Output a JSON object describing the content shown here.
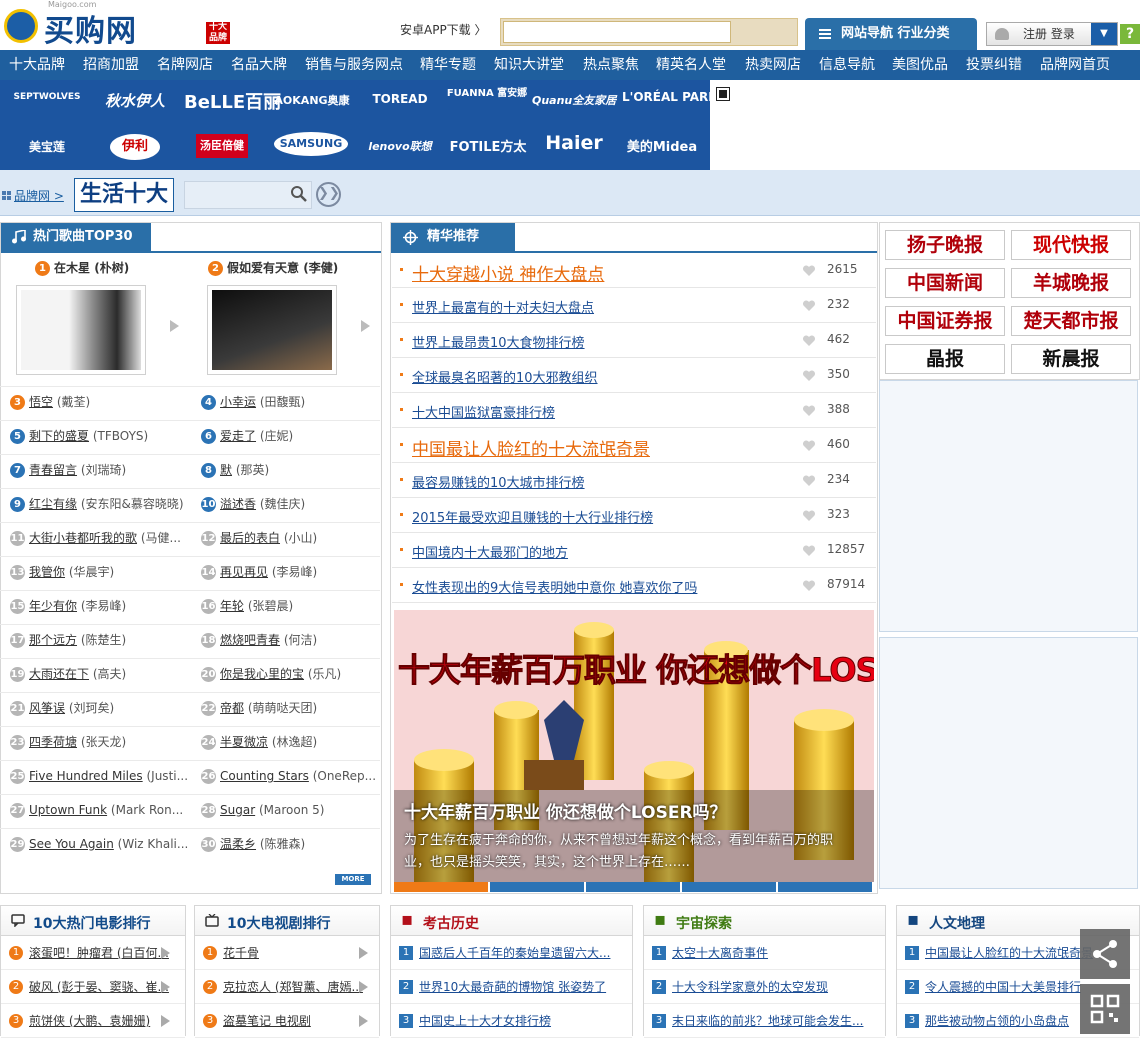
{
  "header": {
    "logo_text": "买购网",
    "logo_sub": "Maigoo.com",
    "logo_badge": "十大品牌",
    "app_download": "安卓APP下载 〉",
    "search_placeholder": "",
    "nav_tab": "网站导航  行业分类",
    "login": "注册 登录",
    "help": "?"
  },
  "nav": [
    "十大品牌",
    "招商加盟",
    "名牌网店",
    "名品大牌",
    "销售与服务网点",
    "精华专题",
    "知识大讲堂",
    "热点聚焦",
    "精英名人堂",
    "热卖网店",
    "信息导航",
    "美图优品",
    "投票纠错",
    "品牌网首页"
  ],
  "brands": [
    {
      "name": "SEPTWOLVES"
    },
    {
      "name": "秋水伊人"
    },
    {
      "name": "BeLLE百丽"
    },
    {
      "name": "AOKANG奥康"
    },
    {
      "name": "TOREAD"
    },
    {
      "name": "FUANNA 富安娜"
    },
    {
      "name": "Quanu全友家居"
    },
    {
      "name": "L'ORÉAL PARIS"
    },
    {
      "name": "美宝莲"
    },
    {
      "name": "伊利"
    },
    {
      "name": "汤臣倍健"
    },
    {
      "name": "SAMSUNG"
    },
    {
      "name": "lenovo联想"
    },
    {
      "name": "FOTILE方太"
    },
    {
      "name": "Haier"
    },
    {
      "name": "美的Midea"
    }
  ],
  "breadcrumb": {
    "link": "品牌网 >",
    "title": "生活十大"
  },
  "songs": {
    "title": "热门歌曲TOP30",
    "top": [
      {
        "rank": "1",
        "title": "在木星",
        "artist": "(朴树)"
      },
      {
        "rank": "2",
        "title": "假如爱有天意",
        "artist": "(李健)"
      }
    ],
    "list": [
      {
        "rank": "3",
        "title": "悟空",
        "artist": "(戴荃)"
      },
      {
        "rank": "4",
        "title": "小幸运",
        "artist": "(田馥甄)"
      },
      {
        "rank": "5",
        "title": "剩下的盛夏",
        "artist": "(TFBOYS)"
      },
      {
        "rank": "6",
        "title": "爱走了",
        "artist": "(庄妮)"
      },
      {
        "rank": "7",
        "title": "青春留言",
        "artist": "(刘瑞琦)"
      },
      {
        "rank": "8",
        "title": "默",
        "artist": "(那英)"
      },
      {
        "rank": "9",
        "title": "红尘有缘",
        "artist": "(安东阳&慕容晓晓)"
      },
      {
        "rank": "10",
        "title": "溢述香",
        "artist": "(魏佳庆)"
      },
      {
        "rank": "11",
        "title": "大街小巷都听我的歌",
        "artist": "(马健..."
      },
      {
        "rank": "12",
        "title": "最后的表白",
        "artist": "(小山)"
      },
      {
        "rank": "13",
        "title": "我管你",
        "artist": "(华晨宇)"
      },
      {
        "rank": "14",
        "title": "再见再见",
        "artist": "(李易峰)"
      },
      {
        "rank": "15",
        "title": "年少有你",
        "artist": "(李易峰)"
      },
      {
        "rank": "16",
        "title": "年轮",
        "artist": "(张碧晨)"
      },
      {
        "rank": "17",
        "title": "那个远方",
        "artist": "(陈楚生)"
      },
      {
        "rank": "18",
        "title": "燃烧吧青春",
        "artist": "(何洁)"
      },
      {
        "rank": "19",
        "title": "大雨还在下",
        "artist": "(高夫)"
      },
      {
        "rank": "20",
        "title": "你是我心里的宝",
        "artist": "(乐凡)"
      },
      {
        "rank": "21",
        "title": "风筝误",
        "artist": "(刘珂矣)"
      },
      {
        "rank": "22",
        "title": "帝都",
        "artist": "(萌萌哒天团)"
      },
      {
        "rank": "23",
        "title": "四季荷塘",
        "artist": "(张天龙)"
      },
      {
        "rank": "24",
        "title": "半夏微凉",
        "artist": "(林逸超)"
      },
      {
        "rank": "25",
        "title": "Five Hundred Miles",
        "artist": "(Justi..."
      },
      {
        "rank": "26",
        "title": "Counting Stars",
        "artist": "(OneRep..."
      },
      {
        "rank": "27",
        "title": "Uptown Funk",
        "artist": "(Mark Ron..."
      },
      {
        "rank": "28",
        "title": "Sugar",
        "artist": "(Maroon 5)"
      },
      {
        "rank": "29",
        "title": "See You Again",
        "artist": "(Wiz Khali..."
      },
      {
        "rank": "30",
        "title": "温柔乡",
        "artist": "(陈雅森)"
      }
    ],
    "more": "MORE"
  },
  "featured": {
    "title": "精华推荐",
    "items": [
      {
        "title": "十大穿越小说 神作大盘点",
        "count": "2615",
        "big": true
      },
      {
        "title": "世界上最富有的十对夫妇大盘点",
        "count": "232"
      },
      {
        "title": "世界上最昂贵10大食物排行榜",
        "count": "462"
      },
      {
        "title": "全球最臭名昭著的10大邪教组织",
        "count": "350"
      },
      {
        "title": "十大中国监狱富豪排行榜",
        "count": "388"
      },
      {
        "title": "中国最让人脸红的十大流氓奇景",
        "count": "460",
        "big": true
      },
      {
        "title": "最容易赚钱的10大城市排行榜",
        "count": "234"
      },
      {
        "title": "2015年最受欢迎且赚钱的十大行业排行榜",
        "count": "323"
      },
      {
        "title": "中国境内十大最邪门的地方",
        "count": "12857"
      },
      {
        "title": "女性表现出的9大信号表明她中意你 她喜欢你了吗",
        "count": "87914"
      }
    ],
    "banner": {
      "headline": "十大年薪百万职业 你还想做个LOSER吗?",
      "caption": "十大年薪百万职业 你还想做个LOSER吗？",
      "desc": "为了生存在疲于奔命的你，从来不曾想过年薪这个概念，看到年薪百万的职业，也只是摇头笑笑，其实，这个世界上存在……"
    }
  },
  "newspapers": [
    "扬子晚报",
    "现代快报",
    "中国新闻",
    "羊城晚报",
    "中国证券报",
    "楚天都市报",
    "晶报",
    "新晨报"
  ],
  "bottom": {
    "movies": {
      "title": "10大热门电影排行",
      "items": [
        {
          "rank": "1",
          "text": "滚蛋吧！肿瘤君 (白百何..."
        },
        {
          "rank": "2",
          "text": "破风 (彭于晏、窦骁、崔..."
        },
        {
          "rank": "3",
          "text": "煎饼侠 (大鹏、袁姗姗)"
        }
      ]
    },
    "tv": {
      "title": "10大电视剧排行",
      "items": [
        {
          "rank": "1",
          "text": "花千骨"
        },
        {
          "rank": "2",
          "text": "克拉恋人 (郑智薰、唐嫣..."
        },
        {
          "rank": "3",
          "text": "盗墓笔记 电视剧"
        }
      ]
    },
    "history": {
      "title": "考古历史",
      "items": [
        {
          "rank": "1",
          "text": "国惑后人千百年的秦始皇遗留六大..."
        },
        {
          "rank": "2",
          "text": "世界10大最奇葩的博物馆 张姿势了"
        },
        {
          "rank": "3",
          "text": "中国史上十大才女排行榜"
        }
      ]
    },
    "space": {
      "title": "宇宙探索",
      "items": [
        {
          "rank": "1",
          "text": "太空十大离奇事件"
        },
        {
          "rank": "2",
          "text": "十大令科学家意外的太空发现"
        },
        {
          "rank": "3",
          "text": "末日来临的前兆？地球可能会发生..."
        }
      ]
    },
    "geo": {
      "title": "人文地理",
      "items": [
        {
          "rank": "1",
          "text": "中国最让人脸红的十大流氓奇景"
        },
        {
          "rank": "2",
          "text": "令人震撼的中国十大美景排行"
        },
        {
          "rank": "3",
          "text": "那些被动物占领的小岛盘点"
        }
      ]
    }
  },
  "colors": {
    "primary": "#1f5f9e",
    "accent": "#ef7a17",
    "brand_strip": "#1c55a0"
  }
}
